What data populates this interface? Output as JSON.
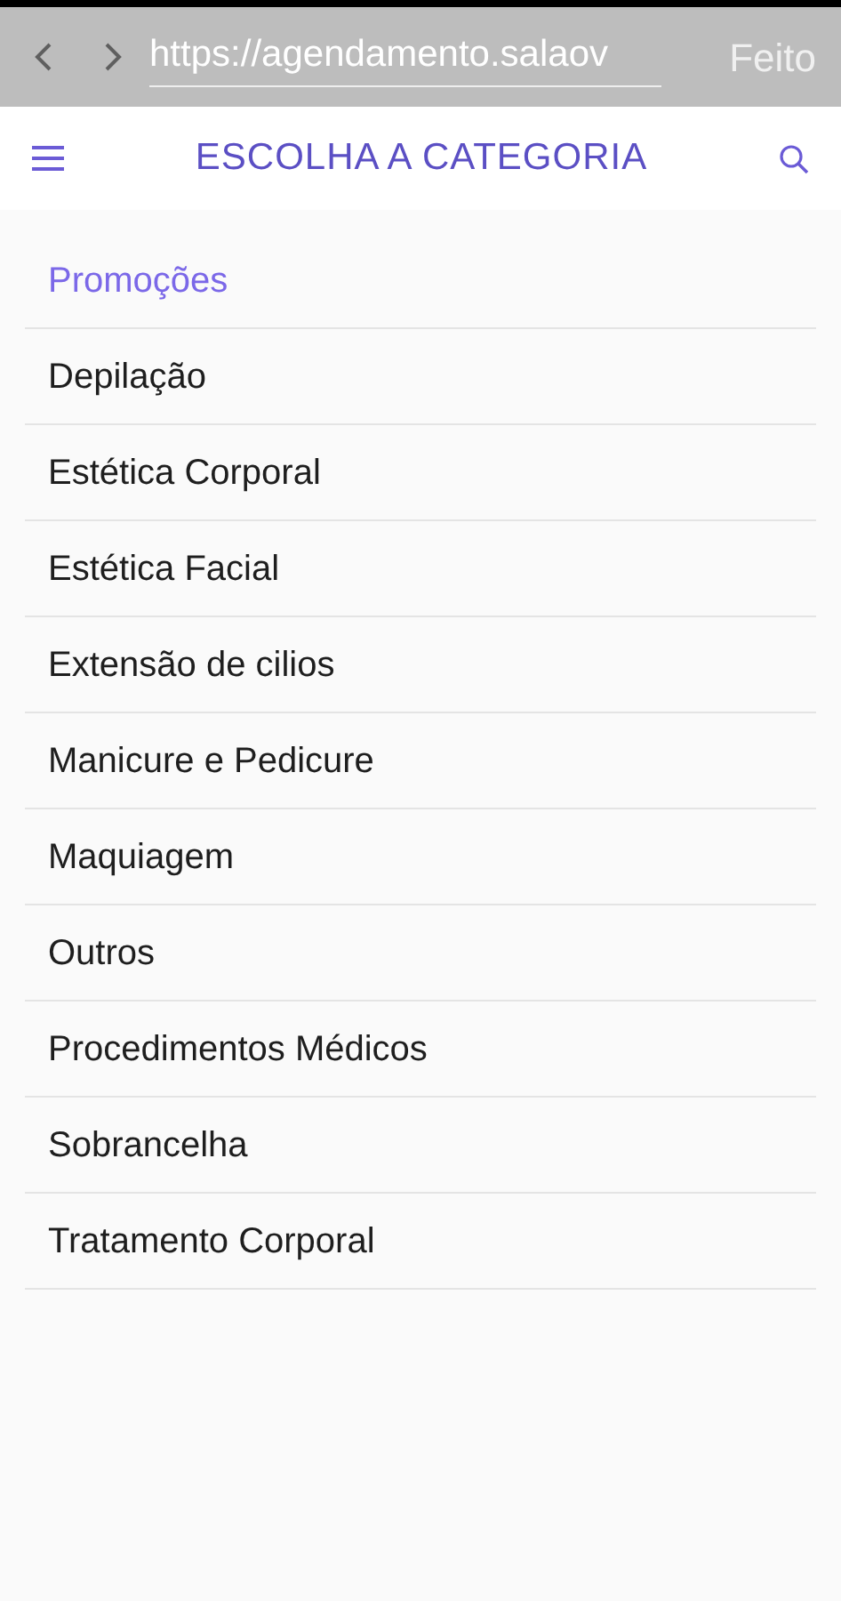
{
  "browser_bar": {
    "url": "https://agendamento.salaov",
    "done_label": "Feito"
  },
  "header": {
    "title": "ESCOLHA A CATEGORIA"
  },
  "categories": [
    {
      "label": "Promoções",
      "highlighted": true
    },
    {
      "label": "Depilação",
      "highlighted": false
    },
    {
      "label": "Estética Corporal",
      "highlighted": false
    },
    {
      "label": "Estética Facial",
      "highlighted": false
    },
    {
      "label": "Extensão de cilios",
      "highlighted": false
    },
    {
      "label": "Manicure e Pedicure",
      "highlighted": false
    },
    {
      "label": "Maquiagem",
      "highlighted": false
    },
    {
      "label": "Outros",
      "highlighted": false
    },
    {
      "label": "Procedimentos Médicos",
      "highlighted": false
    },
    {
      "label": "Sobrancelha",
      "highlighted": false
    },
    {
      "label": "Tratamento Corporal",
      "highlighted": false
    }
  ]
}
